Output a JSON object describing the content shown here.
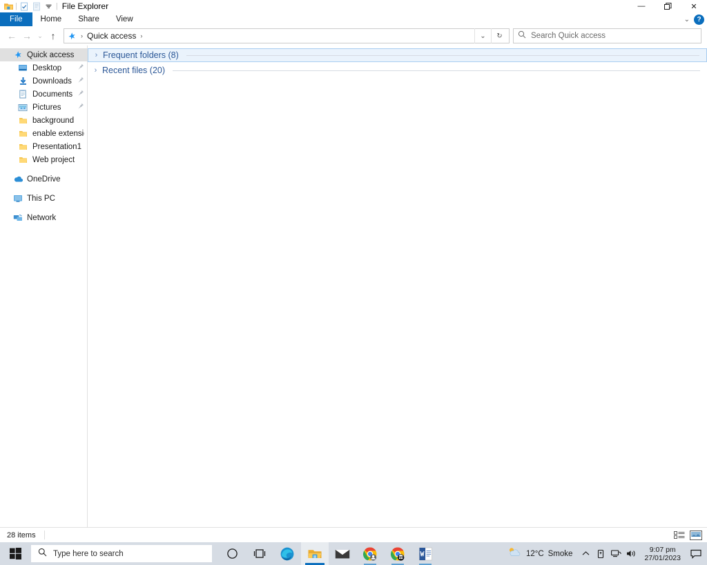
{
  "window": {
    "title": "File Explorer",
    "quick_access_toolbar": [
      {
        "name": "explorer-icon",
        "label": "File Explorer"
      },
      {
        "name": "properties-icon",
        "label": "Properties"
      },
      {
        "name": "new-folder-icon",
        "label": "New folder"
      },
      {
        "name": "customize-chevron-icon",
        "label": "Customize Quick Access Toolbar"
      }
    ],
    "controls": {
      "minimize": "—",
      "maximize": "❐",
      "close": "✕",
      "ribbon_collapse": "⌄",
      "help": "?"
    }
  },
  "ribbon": {
    "tabs": [
      {
        "label": "File",
        "active": true
      },
      {
        "label": "Home",
        "active": false
      },
      {
        "label": "Share",
        "active": false
      },
      {
        "label": "View",
        "active": false
      }
    ],
    "accent_color": "#0b6ebd"
  },
  "navbar": {
    "back": "←",
    "forward": "→",
    "recent_locations": "⌄",
    "up": "↑",
    "breadcrumb": {
      "icon": "quick-access-star-icon",
      "items": [
        "Quick access"
      ],
      "separator": "›"
    },
    "dropdown": "⌄",
    "refresh": "↻"
  },
  "search": {
    "placeholder": "Search Quick access",
    "icon": "search-icon"
  },
  "sidebar": {
    "items": [
      {
        "label": "Quick access",
        "icon": "pin-star-icon",
        "level": 0,
        "selected": true,
        "pinned": false
      },
      {
        "label": "Desktop",
        "icon": "desktop-icon",
        "level": 1,
        "selected": false,
        "pinned": true
      },
      {
        "label": "Downloads",
        "icon": "downloads-icon",
        "level": 1,
        "selected": false,
        "pinned": true
      },
      {
        "label": "Documents",
        "icon": "documents-icon",
        "level": 1,
        "selected": false,
        "pinned": true
      },
      {
        "label": "Pictures",
        "icon": "pictures-icon",
        "level": 1,
        "selected": false,
        "pinned": true
      },
      {
        "label": "background",
        "icon": "folder-icon",
        "level": 1,
        "selected": false,
        "pinned": false
      },
      {
        "label": "enable extension",
        "icon": "folder-icon",
        "level": 1,
        "selected": false,
        "pinned": false
      },
      {
        "label": "Presentation1",
        "icon": "folder-icon",
        "level": 1,
        "selected": false,
        "pinned": false
      },
      {
        "label": "Web project",
        "icon": "folder-icon",
        "level": 1,
        "selected": false,
        "pinned": false
      }
    ],
    "roots": [
      {
        "label": "OneDrive",
        "icon": "onedrive-cloud-icon"
      },
      {
        "label": "This PC",
        "icon": "this-pc-icon"
      },
      {
        "label": "Network",
        "icon": "network-icon"
      }
    ],
    "pin_glyph": "📌"
  },
  "content": {
    "groups": [
      {
        "label": "Frequent folders (8)",
        "collapsed": true,
        "focused": true,
        "chevron": "›"
      },
      {
        "label": "Recent files (20)",
        "collapsed": true,
        "focused": false,
        "chevron": "›"
      }
    ],
    "group_color": "#2b5797"
  },
  "statusbar": {
    "item_count": "28 items",
    "views": [
      {
        "name": "details-view-button",
        "label": "Details view",
        "active": false
      },
      {
        "name": "large-icons-view-button",
        "label": "Large icons view",
        "active": true
      }
    ]
  },
  "taskbar": {
    "start": "start-button",
    "search_placeholder": "Type here to search",
    "apps": [
      {
        "name": "cortana-icon",
        "label": "Cortana",
        "state": "idle"
      },
      {
        "name": "task-view-icon",
        "label": "Task View",
        "state": "idle"
      },
      {
        "name": "edge-icon",
        "label": "Microsoft Edge",
        "state": "idle"
      },
      {
        "name": "file-explorer-icon",
        "label": "File Explorer",
        "state": "active"
      },
      {
        "name": "mail-icon",
        "label": "Mail",
        "state": "idle"
      },
      {
        "name": "chrome-profile-icon",
        "label": "Google Chrome",
        "state": "open"
      },
      {
        "name": "chrome-incognito-icon",
        "label": "Google Chrome",
        "state": "open"
      },
      {
        "name": "word-icon",
        "label": "Microsoft Word",
        "state": "open"
      }
    ],
    "weather": {
      "temperature": "12°C",
      "condition": "Smoke",
      "icon": "sun-cloud-icon"
    },
    "tray": {
      "show_hidden": "⌃",
      "icons": [
        {
          "name": "onedrive-tray-icon"
        },
        {
          "name": "network-tray-icon"
        },
        {
          "name": "volume-tray-icon"
        }
      ]
    },
    "clock": {
      "time": "9:07 pm",
      "date": "27/01/2023"
    },
    "action_center": "notifications-icon",
    "background_color": "#d6dce4"
  }
}
